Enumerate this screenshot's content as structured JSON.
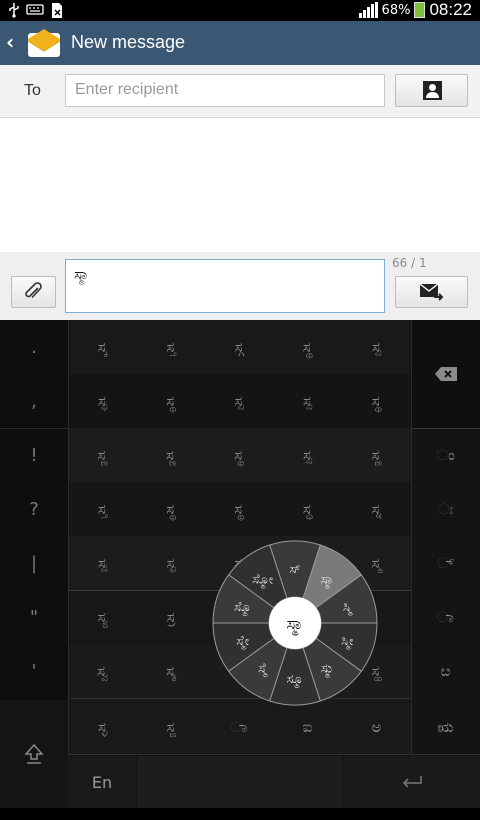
{
  "status_bar": {
    "battery_percent": "68%",
    "time": "08:22",
    "icons": [
      "usb-icon",
      "keyboard-icon",
      "no-sim-icon",
      "signal-icon",
      "battery-icon"
    ]
  },
  "header": {
    "title": "New message",
    "back_icon": "chevron-left-icon",
    "app_icon": "envelope-icon"
  },
  "recipient": {
    "label": "To",
    "placeholder": "Enter recipient"
  },
  "compose": {
    "text": "ಸ್ಮಾ",
    "counter": "66 / 1"
  },
  "keyboard": {
    "left_column": [
      ".",
      ",",
      "!",
      "?",
      "|",
      "\"",
      "'"
    ],
    "rows": [
      [
        "ಸ್ಕ",
        "ಸ್ತ",
        "ಸ್ಗ",
        "ಸ್ಥ",
        "ಸ್ಪ"
      ],
      [
        "ಸ್ಫ",
        "ಸ್ಥ",
        "ಸ್ಪ",
        "ಸ್ಪ",
        "ಸ್ಥ"
      ],
      [
        "ಸ್ಣ",
        "ಸ್ಣ",
        "ಸ್ಥ",
        "ಸ್ಪ",
        "ಸ್ಣ"
      ],
      [
        "ಸ್ತ",
        "ಸ್ಥ",
        "ಸ್ಥ",
        "ಸ್ಧ",
        "ಸ್ನ"
      ],
      [
        "ಸ್ಪ",
        "ಸ್ಫ",
        "ಸ್ಬ",
        "",
        "ಸ್ಮ"
      ],
      [
        "ಸ್ಯ",
        "ಸ್ರ",
        "",
        "",
        ""
      ],
      [
        "ಸ್ವ",
        "ಸ್ಶ",
        "",
        "",
        "ಸ್ಹ"
      ],
      [
        "ಸ್ಳ",
        "ಸ್ಜ",
        "ಾ",
        "ಐ",
        "ಅ"
      ]
    ],
    "right_column": [
      "ಂ",
      "ಃ",
      "್",
      "ಾ",
      "ೞ",
      "ಋ"
    ],
    "lang_label": "En",
    "wheel": {
      "center": "ಸ್ಮಾ",
      "segments": [
        "ಸ್",
        "ಸ್ಮಾ",
        "ಸ್ಮಿ",
        "ಸ್ಮೀ",
        "ಸ್ಮು",
        "ಸ್ಮೂ",
        "ಸ್ಮೆ",
        "ಸ್ಮೇ",
        "ಸ್ಮೊ",
        "ಸ್ಮೋ"
      ]
    }
  }
}
